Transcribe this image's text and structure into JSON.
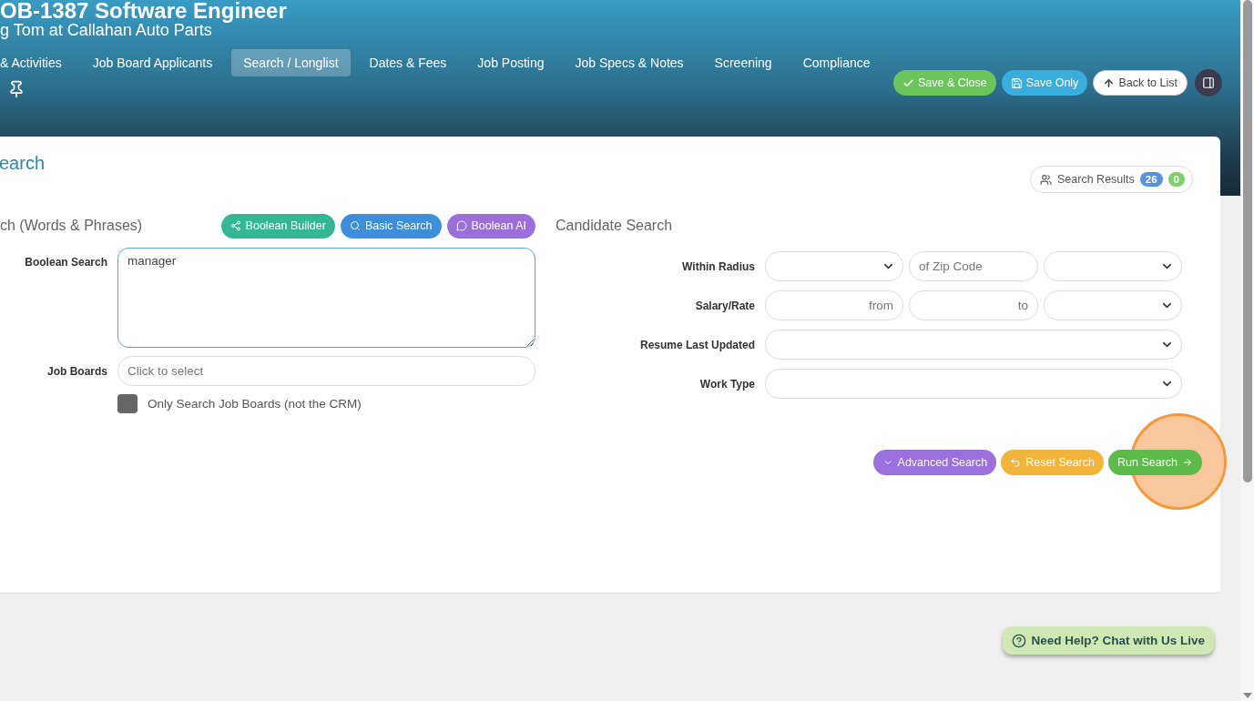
{
  "header": {
    "title": "OB-1387 Software Engineer",
    "subtitle": "g Tom at Callahan Auto Parts"
  },
  "tabs": [
    {
      "label": "& Activities",
      "selected": false
    },
    {
      "label": "Job Board Applicants",
      "selected": false
    },
    {
      "label": "Search / Longlist",
      "selected": true
    },
    {
      "label": "Dates & Fees",
      "selected": false
    },
    {
      "label": "Job Posting",
      "selected": false
    },
    {
      "label": "Job Specs & Notes",
      "selected": false
    },
    {
      "label": "Screening",
      "selected": false
    },
    {
      "label": "Compliance",
      "selected": false
    }
  ],
  "actions": [
    {
      "label": "Save & Close",
      "kind": "save-close"
    },
    {
      "label": "Save Only",
      "kind": "save"
    },
    {
      "label": "Back to List",
      "kind": "back"
    }
  ],
  "page_title": "earch",
  "search_results": {
    "label": "Search Results",
    "counts": [
      {
        "value": "26",
        "color": "#5b8fe0"
      },
      {
        "value": "0",
        "color": "#7fd06c"
      }
    ]
  },
  "keyword_search": {
    "title": "ch (Words & Phrases)",
    "modes": [
      {
        "label": "Boolean Builder",
        "kind": "builder"
      },
      {
        "label": "Basic Search",
        "kind": "basic"
      },
      {
        "label": "Boolean AI",
        "kind": "ai"
      }
    ],
    "boolean_search": {
      "label": "Boolean Search",
      "value": "manager"
    },
    "job_boards": {
      "label": "Job Boards",
      "placeholder": "Click to select"
    },
    "only_job_boards": {
      "label": "Only Search Job Boards (not the CRM)",
      "checked": false
    }
  },
  "candidate_search": {
    "title": "Candidate Search",
    "rows": [
      {
        "label": "Within Radius",
        "fields": [
          {
            "kind": "select"
          },
          {
            "kind": "input",
            "placeholder": "of Zip Code"
          },
          {
            "kind": "select"
          }
        ]
      },
      {
        "label": "Salary/Rate",
        "fields": [
          {
            "kind": "number",
            "placeholder": "from"
          },
          {
            "kind": "number",
            "placeholder": "to"
          },
          {
            "kind": "select"
          }
        ]
      },
      {
        "label": "Resume Last Updated",
        "fields": [
          {
            "kind": "wide-select"
          }
        ]
      },
      {
        "label": "Work Type",
        "fields": [
          {
            "kind": "wide-select"
          }
        ]
      }
    ]
  },
  "buttons": [
    {
      "label": "Advanced Search",
      "kind": "advanced"
    },
    {
      "label": "Reset Search",
      "kind": "reset"
    },
    {
      "label": "Run Search",
      "kind": "run"
    }
  ],
  "help": {
    "label": "Need Help? Chat with Us Live"
  }
}
